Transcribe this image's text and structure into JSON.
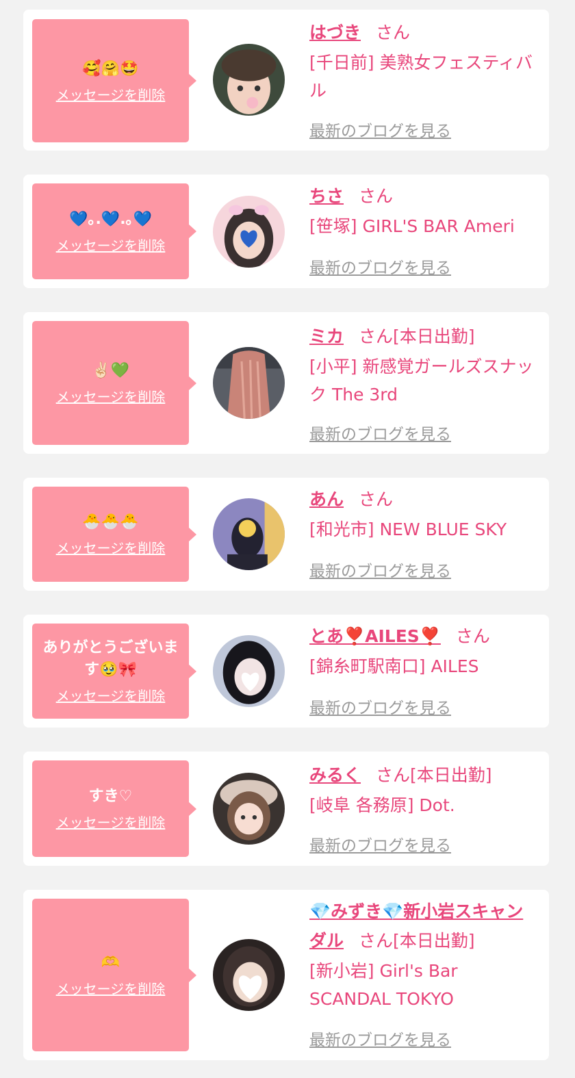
{
  "entries": [
    {
      "message": "🥰🤗🤩",
      "delete_label": "メッセージを削除",
      "name": "はづき",
      "san": "さん",
      "status": "",
      "shop": "[千日前] 美熟女フェスティバル",
      "blog_label": "最新のブログを見る"
    },
    {
      "message": "💙｡.💙.｡💙",
      "delete_label": "メッセージを削除",
      "name": "ちさ",
      "san": "さん",
      "status": "",
      "shop": "[笹塚] GIRL'S BAR Ameri",
      "blog_label": "最新のブログを見る"
    },
    {
      "message": "✌🏻💚",
      "delete_label": "メッセージを削除",
      "name": "ミカ",
      "san": "さん",
      "status": "[本日出勤]",
      "shop": "[小平] 新感覚ガールズスナック The 3rd",
      "blog_label": "最新のブログを見る"
    },
    {
      "message": "🐣🐣🐣",
      "delete_label": "メッセージを削除",
      "name": "あん",
      "san": "さん",
      "status": "",
      "shop": "[和光市] NEW BLUE SKY",
      "blog_label": "最新のブログを見る"
    },
    {
      "message": "ありがとうございます🥹🎀",
      "delete_label": "メッセージを削除",
      "name": "とあ❣️AILES❣️",
      "san": "さん",
      "status": "",
      "shop": "[錦糸町駅南口] AILES",
      "blog_label": "最新のブログを見る"
    },
    {
      "message": "すき♡",
      "delete_label": "メッセージを削除",
      "name": "みるく",
      "san": "さん",
      "status": "[本日出勤]",
      "shop": "[岐阜 各務原] Dot.",
      "blog_label": "最新のブログを見る"
    },
    {
      "message": "🫶",
      "delete_label": "メッセージを削除",
      "name": "💎みずき💎新小岩スキャンダル",
      "san": "さん",
      "status": "[本日出勤]",
      "shop": "[新小岩] Girl's Bar SCANDAL TOKYO",
      "blog_label": "最新のブログを見る"
    }
  ]
}
